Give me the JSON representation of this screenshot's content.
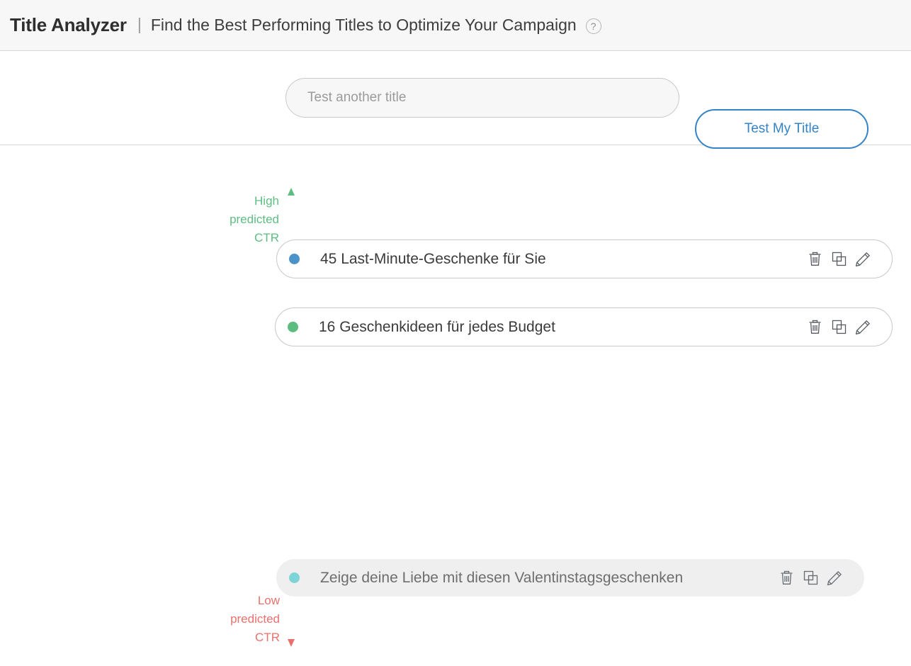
{
  "header": {
    "app_title": "Title Analyzer",
    "separator": "|",
    "subtitle": "Find the Best Performing Titles to Optimize Your Campaign",
    "help_icon_glyph": "?",
    "help_icon_name": "question-mark-icon"
  },
  "search": {
    "placeholder": "Test another title",
    "value": "",
    "button_label": "Test My Title",
    "button_color": "#3483c7"
  },
  "axis": {
    "top_label": "High\npredicted\nCTR",
    "bottom_label": "Low\npredicted\nCTR",
    "top_color": "#5fbd82",
    "bottom_color": "#e8716e",
    "middle_color": "#a8a8a8"
  },
  "actions": {
    "delete_label": "Delete",
    "duplicate_label": "Duplicate",
    "edit_label": "Edit"
  },
  "titles": [
    {
      "text": "45 Last-Minute-Geschenke für Sie",
      "dot_color": "#4a93c9",
      "state": "outlined"
    },
    {
      "text": "16 Geschenkideen für jedes Budget",
      "dot_color": "#5cbd7e",
      "state": "outlined"
    },
    {
      "text": "Zeige deine Liebe mit diesen Valentinstagsgeschenken",
      "dot_color": "#7fd4d8",
      "state": "filled"
    }
  ]
}
